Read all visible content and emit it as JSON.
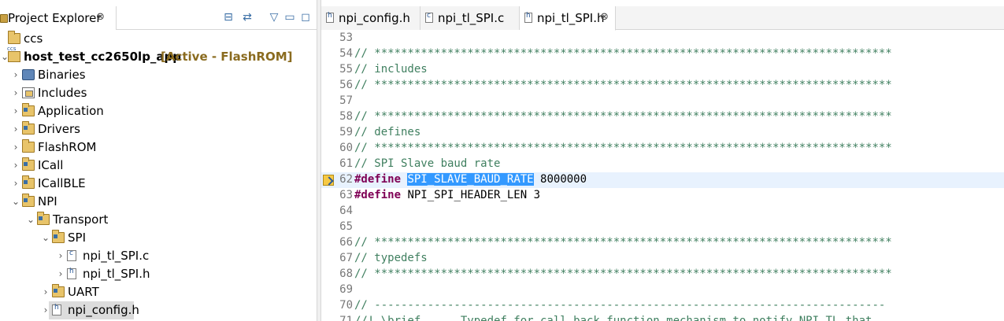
{
  "explorer": {
    "title": "Project Explorer",
    "close_glyph": "⊗",
    "tools": [
      {
        "name": "collapse-all-icon",
        "glyph": "⊟"
      },
      {
        "name": "link-with-editor-icon",
        "glyph": "⇄"
      },
      {
        "name": "view-menu-icon",
        "glyph": "▽"
      },
      {
        "name": "minimize-icon",
        "glyph": "▭"
      },
      {
        "name": "maximize-icon",
        "glyph": "◻"
      }
    ],
    "tree": [
      {
        "label": "ccs",
        "level": 0,
        "chevron": "",
        "icon": "folder"
      },
      {
        "label": "host_test_cc2650lp_app",
        "tag": "[Active - FlashROM]",
        "level": 0,
        "chevron": "⌄",
        "icon": "project",
        "bold": true
      },
      {
        "label": "Binaries",
        "level": 1,
        "chevron": "›",
        "icon": "binaries"
      },
      {
        "label": "Includes",
        "level": 1,
        "chevron": "›",
        "icon": "includes"
      },
      {
        "label": "Application",
        "level": 1,
        "chevron": "›",
        "icon": "srcfolder"
      },
      {
        "label": "Drivers",
        "level": 1,
        "chevron": "›",
        "icon": "srcfolder"
      },
      {
        "label": "FlashROM",
        "level": 1,
        "chevron": "›",
        "icon": "folder"
      },
      {
        "label": "ICall",
        "level": 1,
        "chevron": "›",
        "icon": "srcfolder"
      },
      {
        "label": "ICallBLE",
        "level": 1,
        "chevron": "›",
        "icon": "srcfolder"
      },
      {
        "label": "NPI",
        "level": 1,
        "chevron": "⌄",
        "icon": "srcfolder"
      },
      {
        "label": "Transport",
        "level": 2,
        "chevron": "⌄",
        "icon": "srcfolder"
      },
      {
        "label": "SPI",
        "level": 3,
        "chevron": "⌄",
        "icon": "srcfolder"
      },
      {
        "label": "npi_tl_SPI.c",
        "level": 4,
        "chevron": "›",
        "icon": "cfile"
      },
      {
        "label": "npi_tl_SPI.h",
        "level": 4,
        "chevron": "›",
        "icon": "file"
      },
      {
        "label": "UART",
        "level": 3,
        "chevron": "›",
        "icon": "srcfolder"
      },
      {
        "label": "npi_config.h",
        "level": 3,
        "chevron": "›",
        "icon": "file",
        "selected": true
      }
    ]
  },
  "editor": {
    "tabs": [
      {
        "label": "npi_config.h",
        "type": "h",
        "active": false
      },
      {
        "label": "npi_tl_SPI.c",
        "type": "c",
        "active": false
      },
      {
        "label": "npi_tl_SPI.h",
        "type": "h",
        "active": true,
        "close_glyph": "⊗"
      }
    ],
    "lines": [
      {
        "n": "53",
        "parts": []
      },
      {
        "n": "54",
        "parts": [
          {
            "t": "// ******************************************************************************",
            "c": "cm"
          }
        ]
      },
      {
        "n": "55",
        "parts": [
          {
            "t": "// includes",
            "c": "cm"
          }
        ]
      },
      {
        "n": "56",
        "parts": [
          {
            "t": "// ******************************************************************************",
            "c": "cm"
          }
        ]
      },
      {
        "n": "57",
        "parts": []
      },
      {
        "n": "58",
        "parts": [
          {
            "t": "// ******************************************************************************",
            "c": "cm"
          }
        ]
      },
      {
        "n": "59",
        "parts": [
          {
            "t": "// defines",
            "c": "cm"
          }
        ]
      },
      {
        "n": "60",
        "parts": [
          {
            "t": "// ******************************************************************************",
            "c": "cm"
          }
        ]
      },
      {
        "n": "61",
        "parts": [
          {
            "t": "// SPI Slave baud rate",
            "c": "cm"
          }
        ]
      },
      {
        "n": "62",
        "current": true,
        "marker": true,
        "parts": [
          {
            "t": "#define",
            "c": "kw"
          },
          {
            "t": " ",
            "c": ""
          },
          {
            "t": "SPI_SLAVE_BAUD_RATE",
            "c": "hl"
          },
          {
            "t": " 8000000",
            "c": ""
          }
        ]
      },
      {
        "n": "63",
        "parts": [
          {
            "t": "#define",
            "c": "kw"
          },
          {
            "t": " NPI_SPI_HEADER_LEN 3",
            "c": ""
          }
        ]
      },
      {
        "n": "64",
        "parts": []
      },
      {
        "n": "65",
        "parts": []
      },
      {
        "n": "66",
        "parts": [
          {
            "t": "// ******************************************************************************",
            "c": "cm"
          }
        ]
      },
      {
        "n": "67",
        "parts": [
          {
            "t": "// typedefs",
            "c": "cm"
          }
        ]
      },
      {
        "n": "68",
        "parts": [
          {
            "t": "// ******************************************************************************",
            "c": "cm"
          }
        ]
      },
      {
        "n": "69",
        "parts": []
      },
      {
        "n": "70",
        "parts": [
          {
            "t": "// -----------------------------------------------------------------------------",
            "c": "cm"
          }
        ]
      },
      {
        "n": "71",
        "parts": [
          {
            "t": "//! \\brief      Typedef for call back function mechanism to notify NPI TL that",
            "c": "cm"
          }
        ]
      }
    ]
  }
}
